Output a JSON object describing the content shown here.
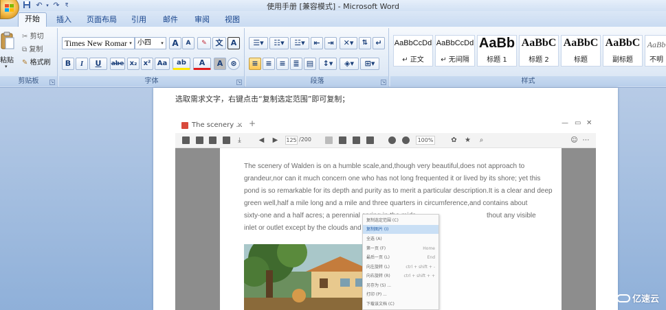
{
  "window": {
    "title": "使用手册 [兼容模式] - Microsoft Word",
    "quick_access": [
      "save-icon",
      "undo-icon",
      "redo-icon",
      "customize-icon"
    ]
  },
  "tabs": [
    "开始",
    "插入",
    "页面布局",
    "引用",
    "邮件",
    "审阅",
    "视图"
  ],
  "active_tab": "开始",
  "clipboard": {
    "paste_label": "粘贴",
    "cut_label": "剪切",
    "copy_label": "复制",
    "format_painter_label": "格式刷",
    "group_label": "剪贴板"
  },
  "font": {
    "font_name": "Times New Romar",
    "font_size": "小四",
    "grow_label": "A",
    "shrink_label": "A",
    "bold": "B",
    "italic": "I",
    "underline": "U",
    "strike": "abe",
    "subscript": "x₂",
    "superscript": "x²",
    "change_case": "Aa",
    "highlight": "ab",
    "font_color": "A",
    "char_shading": "A",
    "phonetic_label": "文",
    "border_char": "A",
    "group_label": "字体"
  },
  "paragraph": {
    "group_label": "段落"
  },
  "styles": {
    "items": [
      {
        "sample": "AaBbCcDd",
        "name": "↵ 正文"
      },
      {
        "sample": "AaBbCcDd",
        "name": "↵ 无间隔"
      },
      {
        "sample": "AaBb",
        "name": "标题 1"
      },
      {
        "sample": "AaBbC",
        "name": "标题 2"
      },
      {
        "sample": "AaBbC",
        "name": "标题"
      },
      {
        "sample": "AaBbC",
        "name": "副标题"
      },
      {
        "sample": "AaBb",
        "name": "不明"
      }
    ],
    "group_label": "样式"
  },
  "document": {
    "paragraph": "选取需求文字，右键点击“复制选定范围”即可复制；"
  },
  "viewer": {
    "tab_title": "The scenery ...",
    "page_current": "125",
    "page_total": "/200",
    "zoom": "100%",
    "lines": [
      "The scenery of Walden is on a humble scale,and,though very beautiful,does not approach to",
      "grandeur,nor can it much concern one who has not long frequented it or lived by its shore; yet this",
      "pond is so remarkable for its depth and purity as to merit a particular description.It is a clear and deep",
      "green well,half a mile long and a mile and three quarters in circumference,and contains about",
      "sixty-one and a half acres; a perennial spring in the mids",
      "inlet or outlet except by the clouds and evaporation."
    ],
    "line5_tail": "thout any visible",
    "context_menu": [
      {
        "label": "复制选定范围  (C)",
        "shortcut": ""
      },
      {
        "label": "复制图片  (I)",
        "shortcut": ""
      },
      {
        "label": "全选  (A)",
        "shortcut": ""
      },
      {
        "label": "第一页  (F)",
        "shortcut": "Home"
      },
      {
        "label": "最后一页  (L)",
        "shortcut": "End"
      },
      {
        "label": "向左旋转  (L)",
        "shortcut": "ctrl + shift + -"
      },
      {
        "label": "向右旋转  (R)",
        "shortcut": "ctrl + shift + +"
      },
      {
        "label": "另存为  (S)  ...",
        "shortcut": ""
      },
      {
        "label": "打印  (P)  ...",
        "shortcut": ""
      },
      {
        "label": "下载该文档  (C)",
        "shortcut": ""
      }
    ],
    "highlighted_item": 1
  },
  "watermark": "亿速云"
}
